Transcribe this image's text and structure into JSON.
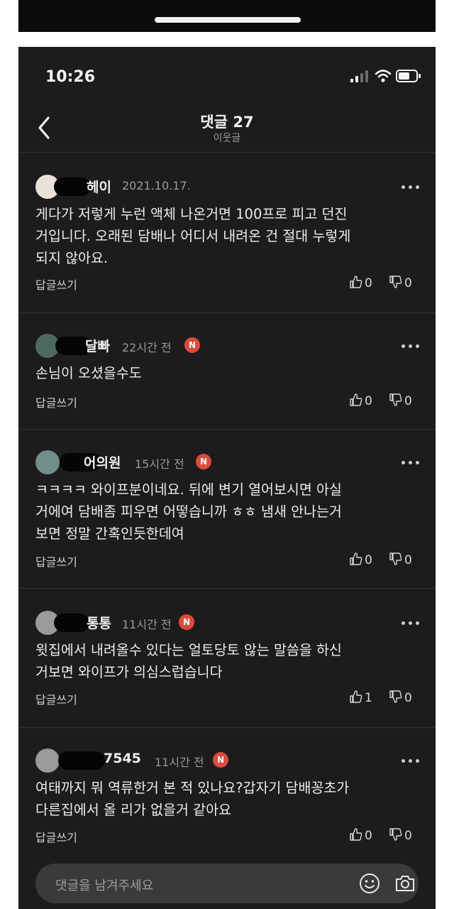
{
  "status": {
    "time": "10:26"
  },
  "header": {
    "title": "댓글 27",
    "subtitle": "이웃글"
  },
  "comments": [
    {
      "author": "헤이",
      "time": "2021.10.17.",
      "new_badge": "",
      "body": "게다가 저렇게 누런 액체 나온거면 100프로 피고 던진\n거입니다. 오래된 담배나 어디서 내려온 건 절대 누렇게\n되지 않아요.",
      "reply": "답글쓰기",
      "likes": "0",
      "dislikes": "0"
    },
    {
      "author": "달빠",
      "time": "22시간 전",
      "new_badge": "N",
      "body": "손님이 오셨을수도",
      "reply": "답글쓰기",
      "likes": "0",
      "dislikes": "0"
    },
    {
      "author": "어의원",
      "time": "15시간 전",
      "new_badge": "N",
      "body": "ㅋㅋㅋㅋ 와이프분이네요. 뒤에 변기 열어보시면 아실\n거에여 담배좀 피우면 어떻습니까 ㅎㅎ 냄새 안나는거\n보면 정말 간혹인듯한데여",
      "reply": "답글쓰기",
      "likes": "0",
      "dislikes": "0"
    },
    {
      "author": "통통",
      "time": "11시간 전",
      "new_badge": "N",
      "body": "윗집에서 내려올수 있다는 얼토당토 않는 말씀을 하신\n거보면 와이프가 의심스럽습니다",
      "reply": "답글쓰기",
      "likes": "1",
      "dislikes": "0"
    },
    {
      "author": "7545",
      "time": "11시간 전",
      "new_badge": "N",
      "body": "여태까지 뭐 역류한거 본 적 있나요?갑자기 담배꽁초가\n다른집에서 올 리가 없을거 같아요",
      "reply": "답글쓰기",
      "likes": "0",
      "dislikes": "0"
    }
  ],
  "input": {
    "placeholder": "댓글을 남겨주세요"
  },
  "colors": {
    "background": "#1c1c1e",
    "badge": "#e04a3a",
    "input_bg": "#3a3a3c"
  },
  "icons": [
    "back-chevron-icon",
    "signal-icon",
    "wifi-icon",
    "battery-icon",
    "more-icon",
    "thumbs-up-icon",
    "thumbs-down-icon",
    "emoji-icon",
    "camera-icon"
  ]
}
